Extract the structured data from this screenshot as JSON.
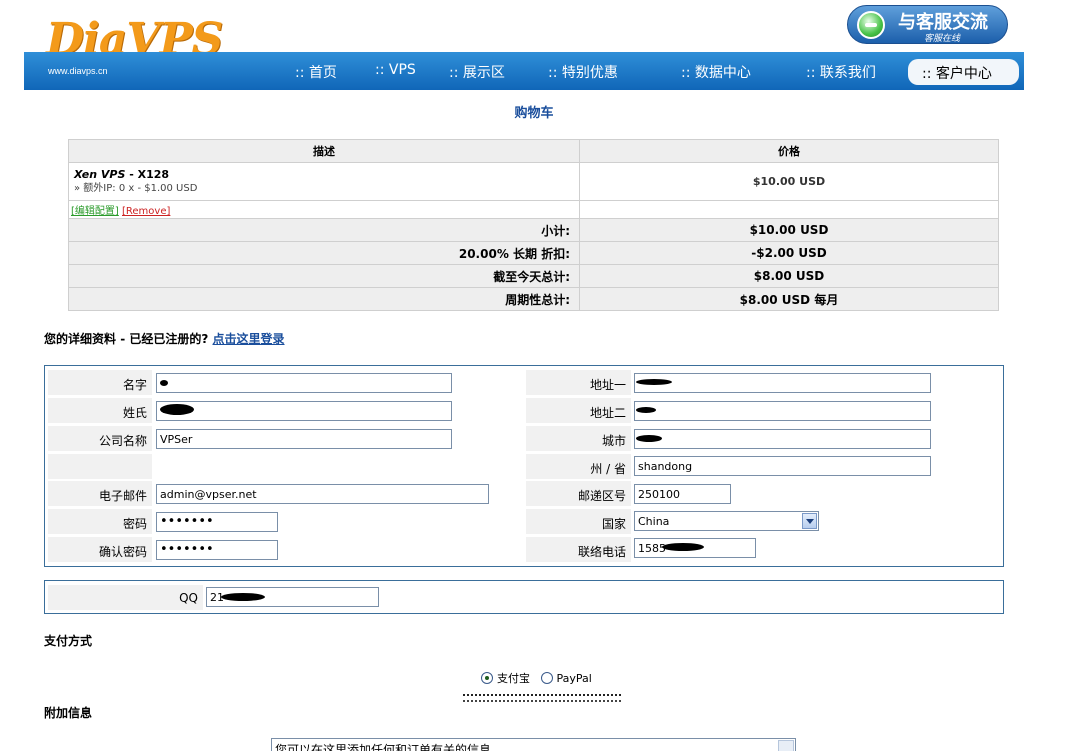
{
  "header": {
    "logo_text": "DiaVPS",
    "logo_url": "www.diavps.cn",
    "support_title": "与客服交流",
    "support_sub": "客服在线",
    "nav": [
      "首页",
      "VPS",
      "展示区",
      "特别优惠",
      "数据中心",
      "联系我们",
      "客户中心"
    ],
    "nav_prefix": "::"
  },
  "cart": {
    "title": "购物车",
    "col_desc": "描述",
    "col_price": "价格",
    "product_name": "Xen VPS",
    "product_plan": "X128",
    "product_addon": "» 额外IP: 0 x - $1.00 USD",
    "product_price": "$10.00 USD",
    "edit_link": "[编辑配置]",
    "remove_link": "[Remove]",
    "summary": [
      {
        "label": "小计:",
        "value": "$10.00 USD"
      },
      {
        "label": "20.00% 长期 折扣:",
        "value": "-$2.00 USD"
      },
      {
        "label": "截至今天总计:",
        "value": "$8.00 USD"
      },
      {
        "label": "周期性总计:",
        "value": "$8.00 USD 每月"
      }
    ]
  },
  "details": {
    "heading": "您的详细资料",
    "registered_prompt": " - 已经已注册的? ",
    "login_link": "点击这里登录",
    "fields": {
      "first_name": {
        "label": "名字",
        "value": ""
      },
      "last_name": {
        "label": "姓氏",
        "value": ""
      },
      "company": {
        "label": "公司名称",
        "value": "VPSer"
      },
      "email": {
        "label": "电子邮件",
        "value": "admin@vpser.net"
      },
      "password": {
        "label": "密码",
        "value": "•••••••"
      },
      "confirm_password": {
        "label": "确认密码",
        "value": "•••••••"
      },
      "address1": {
        "label": "地址一",
        "value": ""
      },
      "address2": {
        "label": "地址二",
        "value": ""
      },
      "city": {
        "label": "城市",
        "value": ""
      },
      "state": {
        "label": "州 / 省",
        "value": "shandong"
      },
      "postcode": {
        "label": "邮递区号",
        "value": "250100"
      },
      "country": {
        "label": "国家",
        "value": "China"
      },
      "phone": {
        "label": "联络电话",
        "value": "1585"
      }
    },
    "qq": {
      "label": "QQ",
      "value": "21"
    }
  },
  "payment": {
    "heading": "支付方式",
    "options": [
      {
        "label": "支付宝",
        "selected": true
      },
      {
        "label": "PayPal",
        "selected": false
      }
    ]
  },
  "notes": {
    "heading": "附加信息",
    "placeholder": "您可以在这里添加任何和订单有关的信息"
  }
}
